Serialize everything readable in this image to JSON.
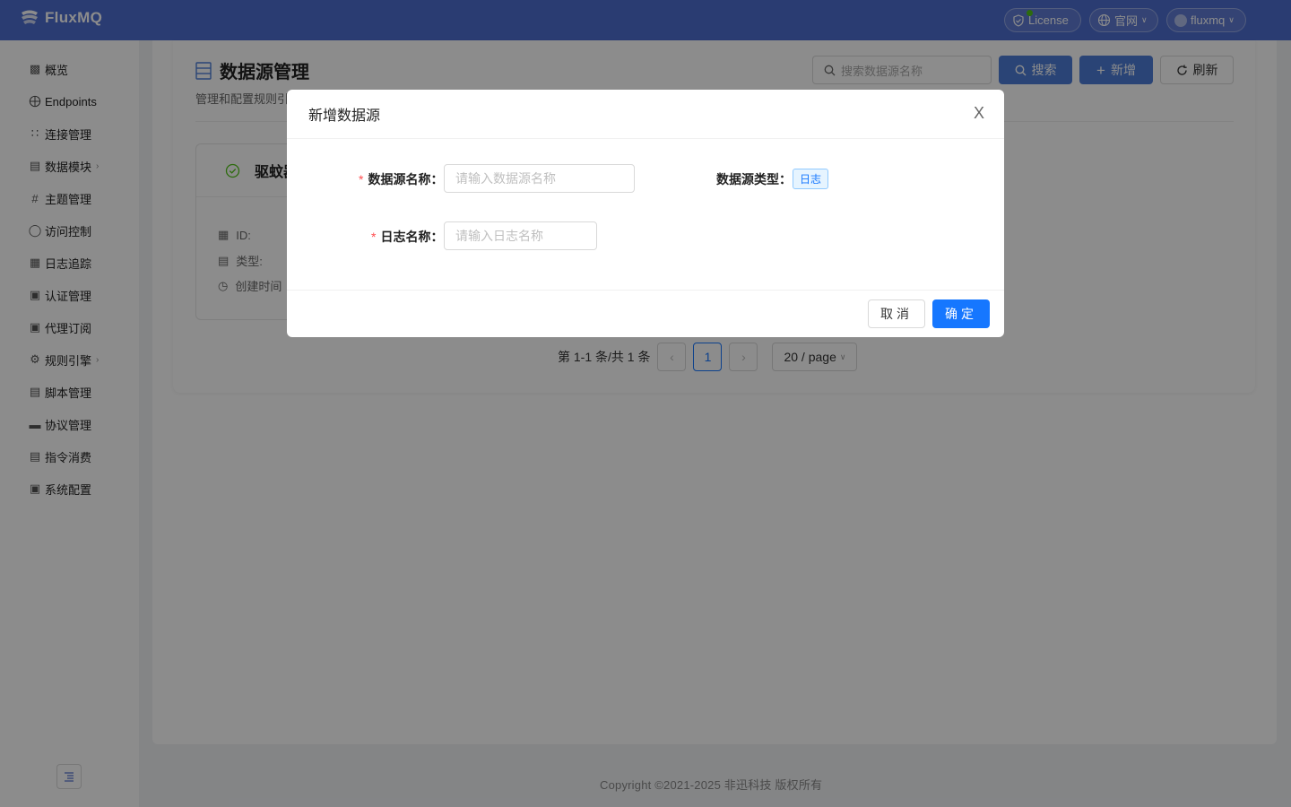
{
  "app": {
    "name": "FluxMQ"
  },
  "topbar": {
    "license_label": "License",
    "official_label": "官网",
    "user_label": "fluxmq"
  },
  "sidebar": {
    "items": [
      {
        "label": "概览",
        "icon": "dashboard-icon"
      },
      {
        "label": "Endpoints",
        "icon": "globe-icon"
      },
      {
        "label": "连接管理",
        "icon": "connection-icon"
      },
      {
        "label": "数据模块",
        "icon": "data-module-icon",
        "has_arrow": true
      },
      {
        "label": "主题管理",
        "icon": "hash-icon"
      },
      {
        "label": "访问控制",
        "icon": "access-icon"
      },
      {
        "label": "日志追踪",
        "icon": "log-icon"
      },
      {
        "label": "认证管理",
        "icon": "auth-icon"
      },
      {
        "label": "代理订阅",
        "icon": "proxy-icon"
      },
      {
        "label": "规则引擎",
        "icon": "rule-icon",
        "has_arrow": true
      },
      {
        "label": "脚本管理",
        "icon": "script-icon"
      },
      {
        "label": "协议管理",
        "icon": "protocol-icon"
      },
      {
        "label": "指令消费",
        "icon": "command-icon"
      },
      {
        "label": "系统配置",
        "icon": "settings-icon"
      }
    ]
  },
  "page": {
    "title": "数据源管理",
    "subtitle": "管理和配置规则引",
    "search_placeholder": "搜索数据源名称",
    "search_button": "搜索",
    "add_button": "新增",
    "refresh_button": "刷新"
  },
  "card": {
    "title": "驱蚊器",
    "id_label": "ID:",
    "type_label": "类型:",
    "created_label": "创建时间"
  },
  "pagination": {
    "summary": "第 1-1 条/共 1 条",
    "current_page": "1",
    "page_size": "20 / page"
  },
  "footer": {
    "copyright": "Copyright ©2021-2025 非迅科技 版权所有"
  },
  "modal": {
    "title": "新增数据源",
    "close_glyph": "X",
    "name_label": "数据源名称",
    "name_placeholder": "请输入数据源名称",
    "type_label": "数据源类型",
    "type_value": "日志",
    "log_name_label": "日志名称",
    "log_name_placeholder": "请输入日志名称",
    "cancel_label": "取消",
    "confirm_label": "确定"
  },
  "colors": {
    "topbar": "#4d6dd0",
    "primary": "#1677ff",
    "required": "#ff4d4f"
  }
}
